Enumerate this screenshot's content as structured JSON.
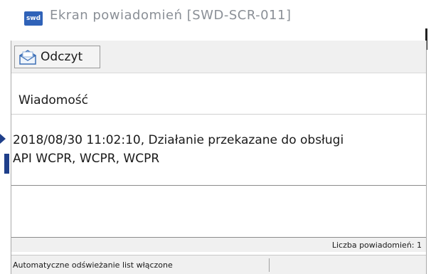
{
  "window": {
    "app_icon_label": "swd",
    "title": "Ekran powiadomień [SWD-SCR-011]"
  },
  "toolbar": {
    "read_label": "Odczyt",
    "read_icon": "envelope-icon"
  },
  "grid": {
    "column_header": "Wiadomość",
    "rows": [
      {
        "line1": "2018/08/30 11:02:10, Działanie przekazane do obsługi",
        "line2": "API WCPR, WCPR, WCPR"
      }
    ]
  },
  "count_bar": {
    "text": "Liczba powiadomień: 1"
  },
  "status_bar": {
    "text": "Automatyczne odświeżanie list włączone"
  },
  "colors": {
    "accent": "#2f62b8",
    "title_text": "#8a8f96",
    "toolbar_bg": "#f0f0f0"
  }
}
